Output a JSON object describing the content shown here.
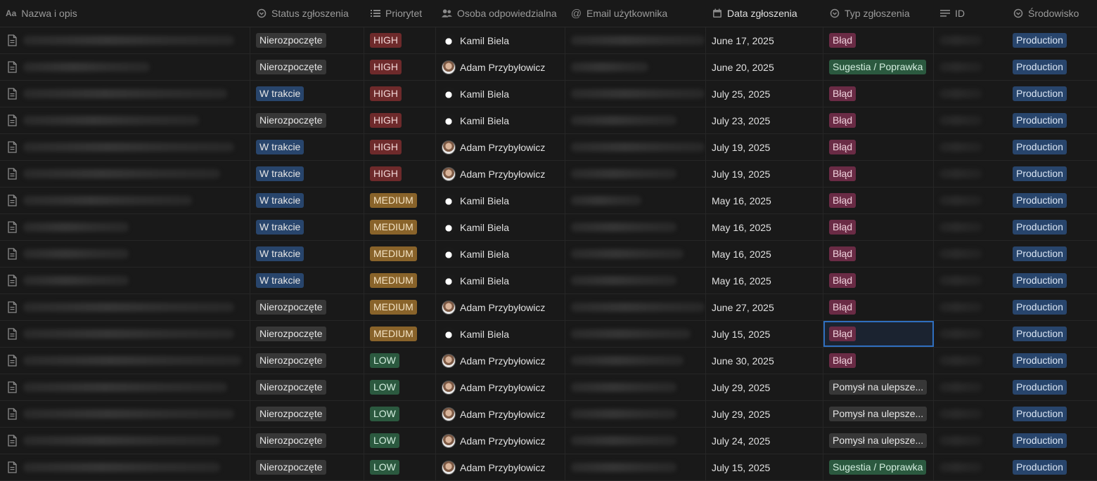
{
  "headers": {
    "name": "Nazwa i opis",
    "status": "Status zgłoszenia",
    "priority": "Priorytet",
    "person": "Osoba odpowiedzialna",
    "email": "Email użytkownika",
    "date": "Data zgłoszenia",
    "type": "Typ zgłoszenia",
    "id": "ID",
    "env": "Środowisko"
  },
  "header_icons": {
    "name": "Aa",
    "status": "status-icon",
    "priority": "list-icon",
    "person": "people-icon",
    "email": "at-icon",
    "date": "calendar-icon",
    "type": "select-icon",
    "id": "text-lines-icon",
    "env": "select-icon"
  },
  "rows": [
    {
      "status": "Nierozpoczęte",
      "priority": "HIGH",
      "person": "Kamil Biela",
      "date": "June 17, 2025",
      "type": "Błąd",
      "env": "Production"
    },
    {
      "status": "Nierozpoczęte",
      "priority": "HIGH",
      "person": "Adam Przybyłowicz",
      "date": "June 20, 2025",
      "type": "Sugestia / Poprawka",
      "env": "Production"
    },
    {
      "status": "W trakcie",
      "priority": "HIGH",
      "person": "Kamil Biela",
      "date": "July 25, 2025",
      "type": "Błąd",
      "env": "Production"
    },
    {
      "status": "Nierozpoczęte",
      "priority": "HIGH",
      "person": "Kamil Biela",
      "date": "July 23, 2025",
      "type": "Błąd",
      "env": "Production"
    },
    {
      "status": "W trakcie",
      "priority": "HIGH",
      "person": "Adam Przybyłowicz",
      "date": "July 19, 2025",
      "type": "Błąd",
      "env": "Production"
    },
    {
      "status": "W trakcie",
      "priority": "HIGH",
      "person": "Adam Przybyłowicz",
      "date": "July 19, 2025",
      "type": "Błąd",
      "env": "Production"
    },
    {
      "status": "W trakcie",
      "priority": "MEDIUM",
      "person": "Kamil Biela",
      "date": "May 16, 2025",
      "type": "Błąd",
      "env": "Production"
    },
    {
      "status": "W trakcie",
      "priority": "MEDIUM",
      "person": "Kamil Biela",
      "date": "May 16, 2025",
      "type": "Błąd",
      "env": "Production"
    },
    {
      "status": "W trakcie",
      "priority": "MEDIUM",
      "person": "Kamil Biela",
      "date": "May 16, 2025",
      "type": "Błąd",
      "env": "Production"
    },
    {
      "status": "W trakcie",
      "priority": "MEDIUM",
      "person": "Kamil Biela",
      "date": "May 16, 2025",
      "type": "Błąd",
      "env": "Production"
    },
    {
      "status": "Nierozpoczęte",
      "priority": "MEDIUM",
      "person": "Adam Przybyłowicz",
      "date": "June 27, 2025",
      "type": "Błąd",
      "env": "Production"
    },
    {
      "status": "Nierozpoczęte",
      "priority": "MEDIUM",
      "person": "Kamil Biela",
      "date": "July 15, 2025",
      "type": "Błąd",
      "env": "Production"
    },
    {
      "status": "Nierozpoczęte",
      "priority": "LOW",
      "person": "Adam Przybyłowicz",
      "date": "June 30, 2025",
      "type": "Błąd",
      "env": "Production"
    },
    {
      "status": "Nierozpoczęte",
      "priority": "LOW",
      "person": "Adam Przybyłowicz",
      "date": "July 29, 2025",
      "type": "Pomysł na ulepsze...",
      "env": "Production"
    },
    {
      "status": "Nierozpoczęte",
      "priority": "LOW",
      "person": "Adam Przybyłowicz",
      "date": "July 29, 2025",
      "type": "Pomysł na ulepsze...",
      "env": "Production"
    },
    {
      "status": "Nierozpoczęte",
      "priority": "LOW",
      "person": "Adam Przybyłowicz",
      "date": "July 24, 2025",
      "type": "Pomysł na ulepsze...",
      "env": "Production"
    },
    {
      "status": "Nierozpoczęte",
      "priority": "LOW",
      "person": "Adam Przybyłowicz",
      "date": "July 15, 2025",
      "type": "Sugestia / Poprawka",
      "env": "Production"
    }
  ],
  "colors": {
    "background": "#191919",
    "status_gray": "#373737",
    "status_blue": "#28456c",
    "priority_high": "#6e2a2b",
    "priority_medium": "#89632a",
    "priority_low": "#2b593f",
    "type_bug": "#6a2b45",
    "type_suggestion": "#2b593f",
    "env_production": "#28456c",
    "selection": "#2f6fbf"
  }
}
